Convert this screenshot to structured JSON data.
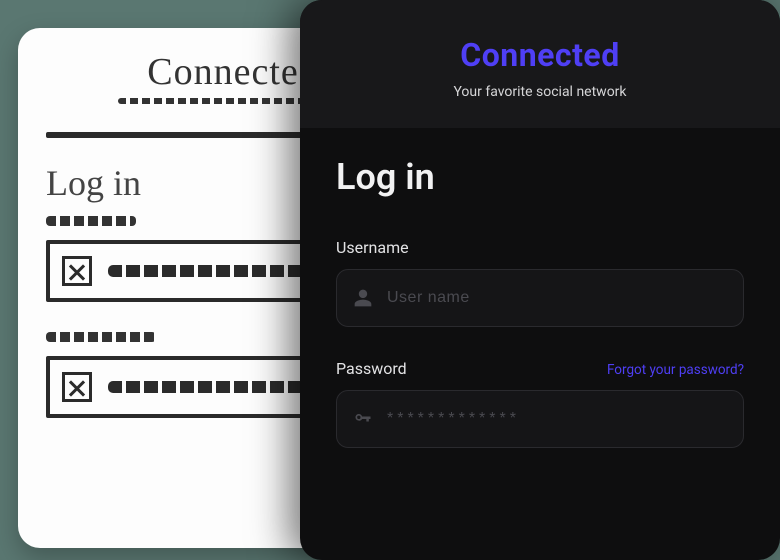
{
  "sketch": {
    "title": "Connected",
    "heading": "Log in"
  },
  "app": {
    "brand": "Connected",
    "tagline": "Your favorite social network",
    "form_title": "Log in",
    "username": {
      "label": "Username",
      "placeholder": "User name",
      "value": ""
    },
    "password": {
      "label": "Password",
      "placeholder": "*************",
      "value": "",
      "forgot_label": "Forgot your password?"
    },
    "colors": {
      "accent": "#4f3ff5",
      "bg_card": "#0e0e0f",
      "bg_header": "#18181a"
    }
  }
}
